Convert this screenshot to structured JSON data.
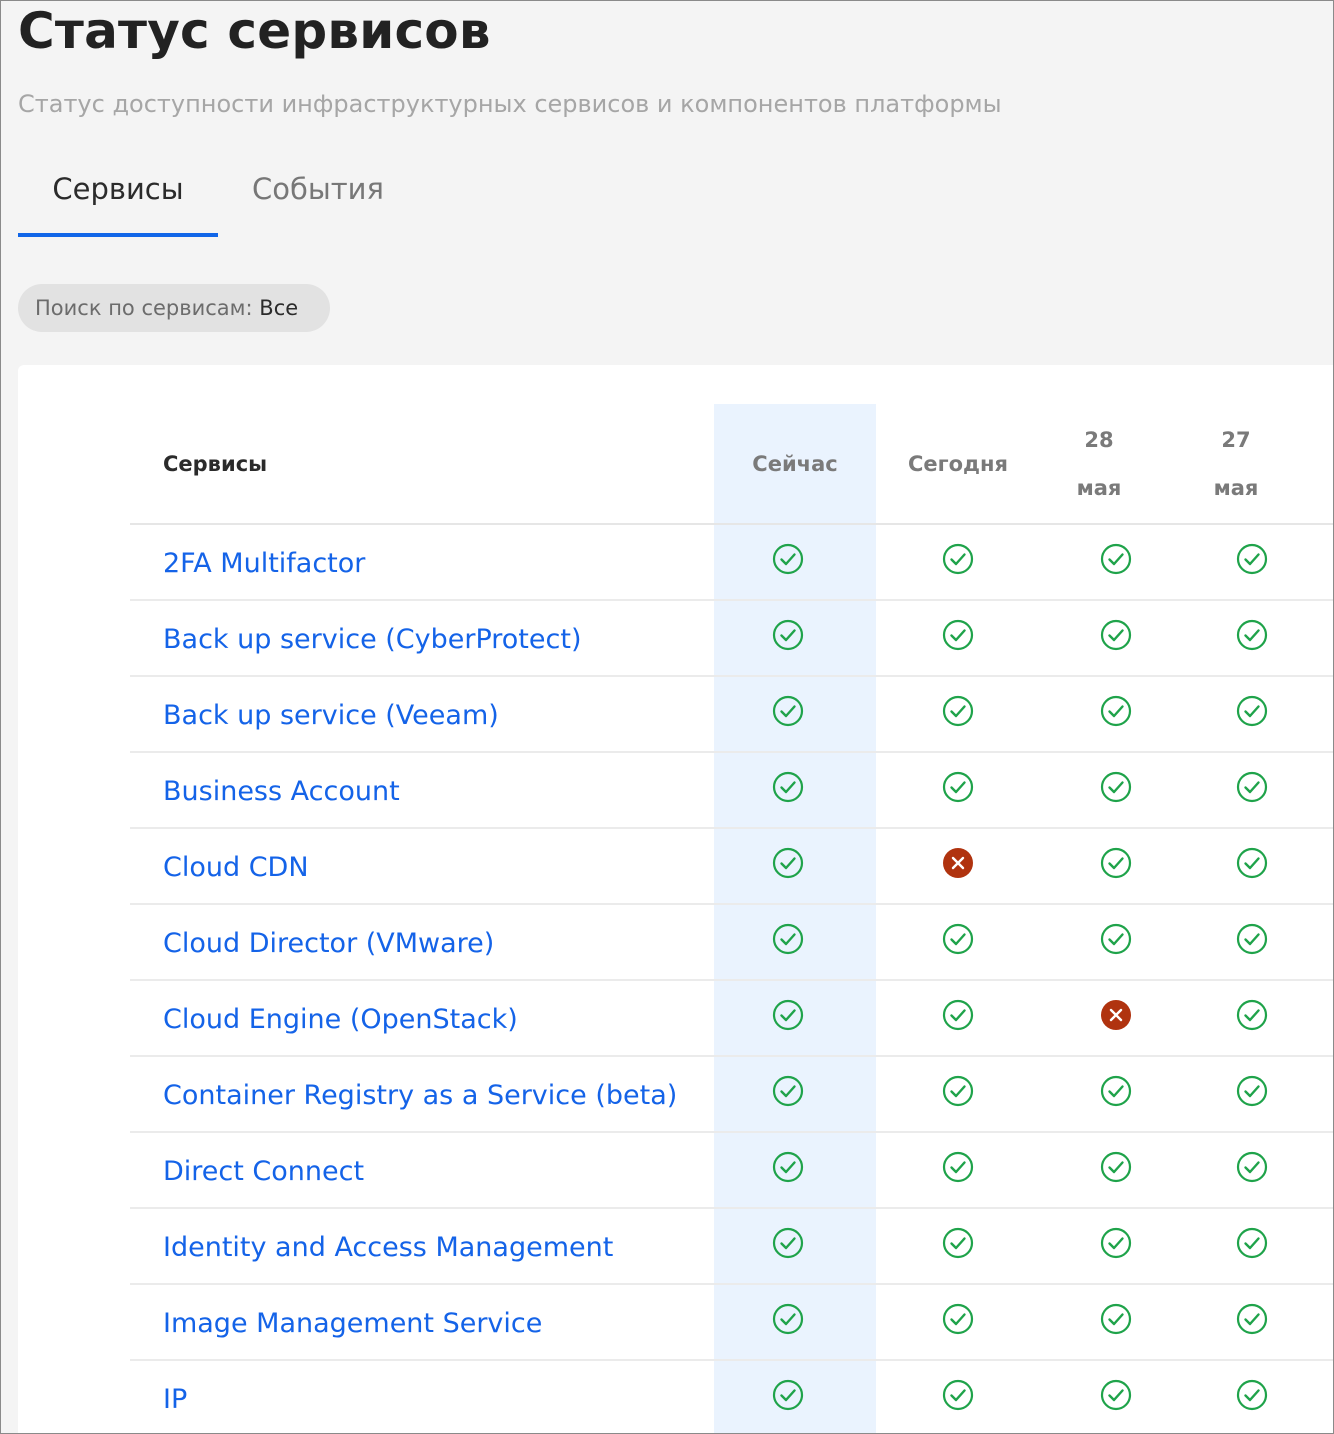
{
  "header": {
    "title": "Статус сервисов",
    "subtitle": "Статус доступности инфраструктурных сервисов и компонентов платформы"
  },
  "tabs": [
    {
      "label": "Сервисы",
      "active": true
    },
    {
      "label": "События",
      "active": false
    }
  ],
  "filter": {
    "label": "Поиск по сервисам:",
    "value": "Все"
  },
  "table": {
    "columns": {
      "services": "Сервисы",
      "now": "Сейчас",
      "today": "Сегодня",
      "d28_day": "28",
      "d28_month": "мая",
      "d27_day": "27",
      "d27_month": "мая"
    },
    "rows": [
      {
        "name": "2FA Multifactor",
        "statuses": [
          "ok",
          "ok",
          "ok",
          "ok"
        ]
      },
      {
        "name": "Back up service (CyberProtect)",
        "statuses": [
          "ok",
          "ok",
          "ok",
          "ok"
        ]
      },
      {
        "name": "Back up service (Veeam)",
        "statuses": [
          "ok",
          "ok",
          "ok",
          "ok"
        ]
      },
      {
        "name": "Business Account",
        "statuses": [
          "ok",
          "ok",
          "ok",
          "ok"
        ]
      },
      {
        "name": "Cloud CDN",
        "statuses": [
          "ok",
          "error",
          "ok",
          "ok"
        ]
      },
      {
        "name": "Cloud Director (VMware)",
        "statuses": [
          "ok",
          "ok",
          "ok",
          "ok"
        ]
      },
      {
        "name": "Cloud Engine (OpenStack)",
        "statuses": [
          "ok",
          "ok",
          "error",
          "ok"
        ]
      },
      {
        "name": "Container Registry as a Service (beta)",
        "statuses": [
          "ok",
          "ok",
          "ok",
          "ok"
        ]
      },
      {
        "name": "Direct Connect",
        "statuses": [
          "ok",
          "ok",
          "ok",
          "ok"
        ]
      },
      {
        "name": "Identity and Access Management",
        "statuses": [
          "ok",
          "ok",
          "ok",
          "ok"
        ]
      },
      {
        "name": "Image Management Service",
        "statuses": [
          "ok",
          "ok",
          "ok",
          "ok"
        ]
      },
      {
        "name": "IP",
        "statuses": [
          "ok",
          "ok",
          "ok",
          "ok"
        ]
      }
    ]
  },
  "colors": {
    "accent": "#1166e8",
    "link": "#1463e8",
    "ok": "#1fa34a",
    "error": "#b0330f",
    "now_column_bg": "#eaf3fe"
  },
  "icons": {
    "ok": "check-circle-icon",
    "error": "x-circle-icon"
  }
}
